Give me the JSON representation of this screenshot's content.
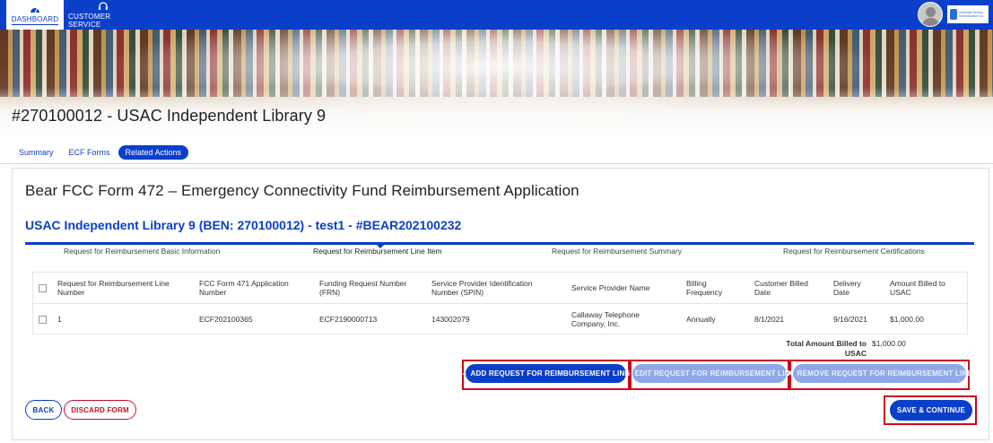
{
  "nav": {
    "dashboard_label": "DASHBOARD",
    "customer_service_label": "CUSTOMER SERVICE",
    "logo_text": "Universal Service Administrative Co."
  },
  "page": {
    "title": "#270100012 - USAC Independent Library 9"
  },
  "tabs": [
    {
      "label": "Summary",
      "active": false
    },
    {
      "label": "ECF Forms",
      "active": false
    },
    {
      "label": "Related Actions",
      "active": true
    }
  ],
  "form": {
    "title": "Bear FCC Form 472 – Emergency Connectivity Fund Reimbursement Application",
    "subtitle": "USAC Independent Library 9 (BEN: 270100012) - test1 - #BEAR202100232"
  },
  "steps": [
    {
      "label": "Request for Reimbursement Basic Information",
      "current": false
    },
    {
      "label": "Request for Reimbursement Line Item",
      "current": true
    },
    {
      "label": "Request for Reimbursement Summary",
      "current": false
    },
    {
      "label": "Request for Reimbursement Certifications",
      "current": false
    }
  ],
  "table": {
    "headers": [
      "Request for Reimbursement Line Number",
      "FCC Form 471 Application Number",
      "Funding Request Number (FRN)",
      "Service Provider Identification Number (SPIN)",
      "Service Provider Name",
      "Billing Frequency",
      "Customer Billed Date",
      "Delivery Date",
      "Amount Billed to USAC"
    ],
    "rows": [
      [
        "1",
        "ECF202100365",
        "ECF2190000713",
        "143002079",
        "Callaway Telephone Company, Inc.",
        "Annually",
        "8/1/2021",
        "9/16/2021",
        "$1,000.00"
      ]
    ]
  },
  "total": {
    "label": "Total Amount Billed to USAC",
    "value": "$1,000.00"
  },
  "actions": {
    "add_label": "ADD REQUEST FOR REIMBURSEMENT LINE",
    "edit_label": "EDIT REQUEST FOR REIMBURSEMENT LINE",
    "remove_label": "REMOVE REQUEST FOR REIMBURSEMENT LINE",
    "back_label": "BACK",
    "discard_label": "DISCARD FORM",
    "save_label": "SAVE & CONTINUE"
  },
  "colors": {
    "brand_blue": "#0a3fc9",
    "highlight_red": "#d0021b",
    "disabled_blue": "#8fa8e8"
  },
  "icons": {
    "dashboard": "speedometer-icon",
    "customer_service": "headset-icon",
    "add": "plus-icon",
    "edit": "pencil-icon",
    "remove": "x-icon"
  }
}
